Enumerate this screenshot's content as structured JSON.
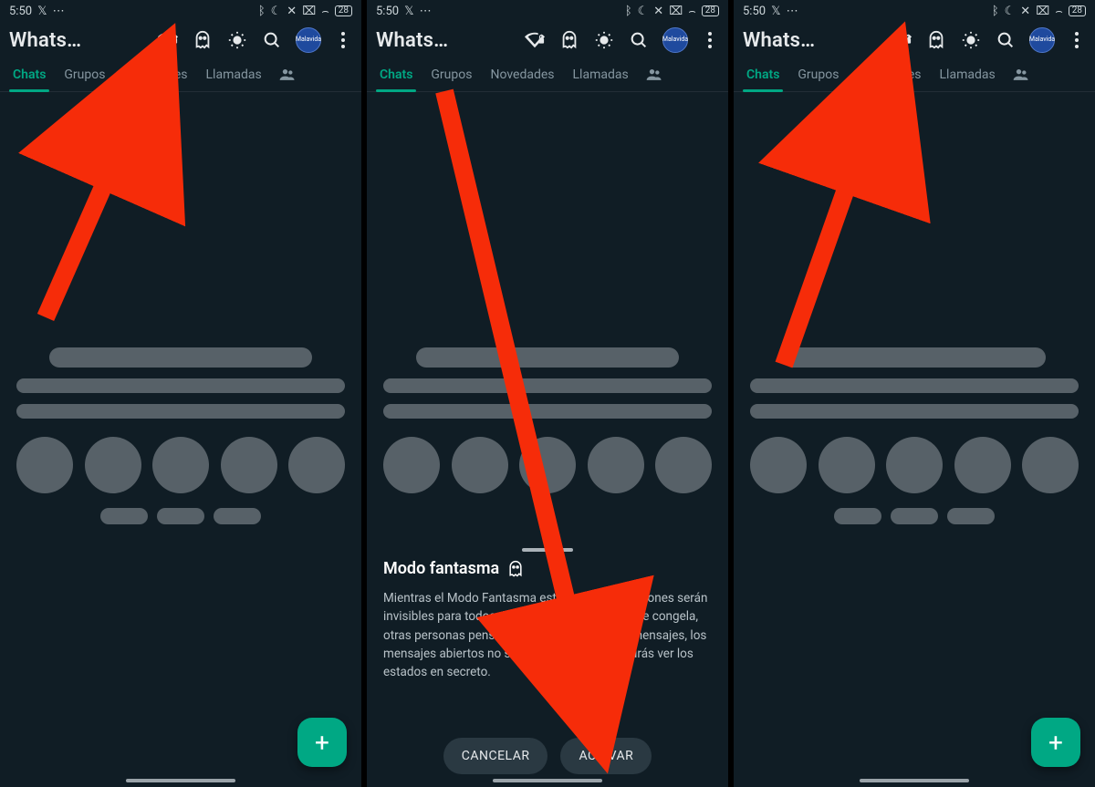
{
  "status": {
    "time": "5:50",
    "left_icons": [
      "X",
      "⋯"
    ],
    "right_icons": [
      "bluetooth",
      "moon",
      "mute",
      "x-box",
      "wifi"
    ],
    "battery": "28"
  },
  "header": {
    "title": "Whats…",
    "avatar_label": "Malavida",
    "icons": {
      "wifi_lock": "wifi-lock",
      "ghost": "ghost",
      "brightness": "brightness",
      "search": "search",
      "menu": "menu"
    }
  },
  "tabs": {
    "chats": "Chats",
    "grupos": "Grupos",
    "novedades": "Novedades",
    "llamadas": "Llamadas"
  },
  "fab": {
    "label": "+"
  },
  "sheet": {
    "title": "Modo fantasma",
    "body": "Mientras el Modo Fantasma esté activo, tus acciones serán invisibles para todos. La última vez que vistas se congela, otras personas pensarán que no recibiste los mensajes, los mensajes abiertos no se volverán azules y podrás ver los estados en secreto.",
    "cancel": "CANCELAR",
    "confirm": "ACTIVAR"
  },
  "colors": {
    "accent": "#00a884",
    "bg": "#101d25",
    "arrow": "#f62c09"
  }
}
